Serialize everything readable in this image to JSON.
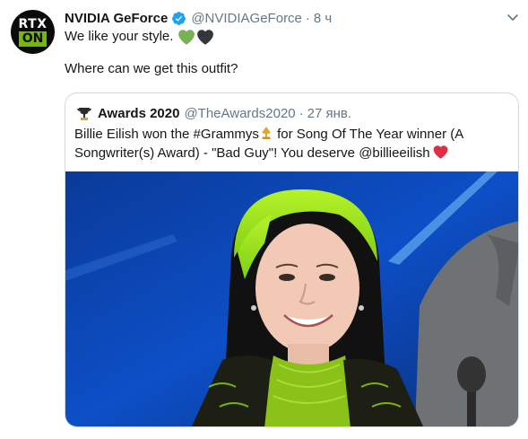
{
  "tweet": {
    "author_name": "NVIDIA GeForce",
    "author_handle": "@NVIDIAGeForce",
    "separator": "·",
    "time": "8 ч",
    "avatar_text_top": "RTX",
    "avatar_text_bottom": "ON",
    "line1": "We like your style.",
    "line2": "Where can we get this outfit?",
    "menu_icon": "chevron-down-icon",
    "emoji": [
      "green-heart-icon",
      "black-heart-icon"
    ]
  },
  "quote": {
    "author_name": "Awards 2020",
    "author_handle": "@TheAwards2020",
    "separator": "·",
    "time": "27 янв.",
    "text_part1": "Billie Eilish won the #Grammys",
    "text_part2": " for Song Of The Year winner (A Songwriter(s) Award) - \"Bad Guy\"! You deserve @billieeilish",
    "avatar_icon": "trophy-avatar-icon",
    "emoji": [
      "gramophone-icon",
      "red-heart-icon"
    ]
  },
  "colors": {
    "accent_green": "#76b900",
    "verified_blue": "#1da1f2",
    "muted": "#657786",
    "heart_green": "#77b255",
    "heart_black": "#31373d",
    "heart_red": "#dd2e44"
  }
}
